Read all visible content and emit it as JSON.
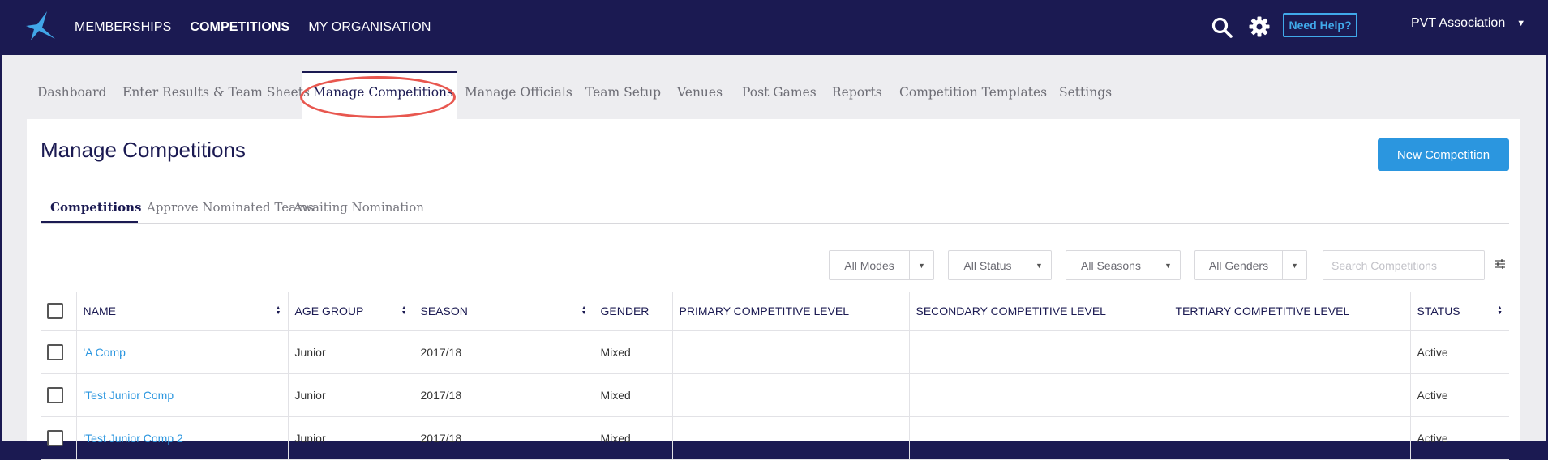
{
  "topnav": {
    "items": [
      {
        "label": "MEMBERSHIPS",
        "active": false
      },
      {
        "label": "COMPETITIONS",
        "active": true
      },
      {
        "label": "MY ORGANISATION",
        "active": false
      }
    ],
    "help_label": "Need Help?",
    "org_name": "PVT Association"
  },
  "subnav": {
    "items": [
      "Dashboard",
      "Enter Results & Team Sheets",
      "Manage Competitions",
      "Manage Officials",
      "Team Setup",
      "Venues",
      "Post Games",
      "Reports",
      "Competition Templates",
      "Settings"
    ],
    "active_index": 2
  },
  "main": {
    "title": "Manage Competitions",
    "new_button": "New Competition",
    "tabs": [
      "Competitions",
      "Approve Nominated Teams",
      "Awaiting Nomination"
    ],
    "filters": [
      "All Modes",
      "All Status",
      "All Seasons",
      "All Genders"
    ],
    "search_placeholder": "Search Competitions",
    "table": {
      "headers": [
        "NAME",
        "AGE GROUP",
        "SEASON",
        "GENDER",
        "PRIMARY COMPETITIVE LEVEL",
        "SECONDARY COMPETITIVE LEVEL",
        "TERTIARY COMPETITIVE LEVEL",
        "STATUS"
      ],
      "rows": [
        {
          "name": "'A Comp",
          "age_group": "Junior",
          "season": "2017/18",
          "gender": "Mixed",
          "primary": "",
          "secondary": "",
          "tertiary": "",
          "status": "Active"
        },
        {
          "name": "'Test Junior Comp",
          "age_group": "Junior",
          "season": "2017/18",
          "gender": "Mixed",
          "primary": "",
          "secondary": "",
          "tertiary": "",
          "status": "Active"
        },
        {
          "name": "'Test Junior Comp 2",
          "age_group": "Junior",
          "season": "2017/18",
          "gender": "Mixed",
          "primary": "",
          "secondary": "",
          "tertiary": "",
          "status": "Active"
        }
      ]
    }
  },
  "colors": {
    "navy": "#1b1a52",
    "accent_blue": "#2b96df",
    "highlight": "#e8574f"
  }
}
